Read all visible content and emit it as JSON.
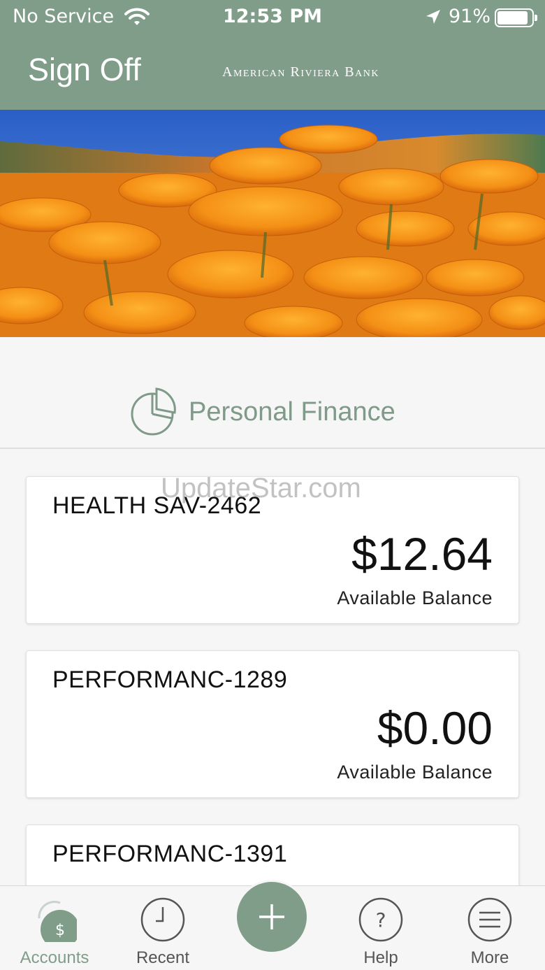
{
  "status_bar": {
    "carrier": "No Service",
    "time": "12:53 PM",
    "battery_percent": "91%",
    "battery_level": 0.91
  },
  "header": {
    "sign_off_label": "Sign Off",
    "bank_name": "American Riviera Bank",
    "background_color": "#809d8a"
  },
  "hero": {
    "image_subject": "orange-poppies-field"
  },
  "personal_finance": {
    "label": "Personal Finance",
    "icon": "pie-chart-icon"
  },
  "accounts": [
    {
      "name": "HEALTH SAV-2462",
      "balance": "$12.64",
      "balance_label": "Available Balance"
    },
    {
      "name": "PERFORMANC-1289",
      "balance": "$0.00",
      "balance_label": "Available Balance"
    },
    {
      "name": "PERFORMANC-1391",
      "balance": "",
      "balance_label": ""
    }
  ],
  "watermark": "UpdateStar.com",
  "tab_bar": {
    "tabs": [
      {
        "label": "Accounts",
        "icon": "dollar-icon",
        "active": true
      },
      {
        "label": "Recent",
        "icon": "clock-icon",
        "active": false
      },
      {
        "label": "",
        "icon": "plus-icon",
        "active": false
      },
      {
        "label": "Help",
        "icon": "question-icon",
        "active": false
      },
      {
        "label": "More",
        "icon": "menu-icon",
        "active": false
      }
    ],
    "accent_color": "#809d8a"
  }
}
